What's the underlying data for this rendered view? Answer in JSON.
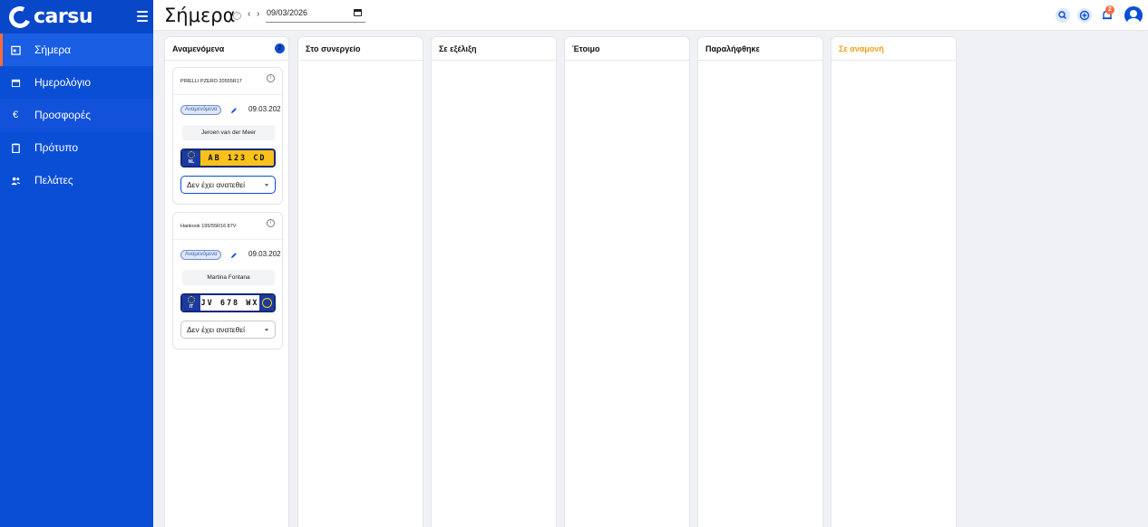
{
  "brand": {
    "name": "carsu"
  },
  "sidebar": {
    "items": [
      {
        "label": "Σήμερα",
        "icon": "today-icon"
      },
      {
        "label": "Ημερολόγιο",
        "icon": "calendar-icon"
      },
      {
        "label": "Προσφορές",
        "icon": "euro-icon"
      },
      {
        "label": "Πρότυπο",
        "icon": "clipboard-icon"
      },
      {
        "label": "Πελάτες",
        "icon": "users-icon"
      }
    ]
  },
  "header": {
    "title": "Σήμερα",
    "date": "09/03/2026",
    "notification_count": "2"
  },
  "columns": [
    {
      "title": "Αναμενόμενα",
      "count": "2",
      "color": "#111111"
    },
    {
      "title": "Στο συνεργείο",
      "color": "#111111"
    },
    {
      "title": "Σε εξέλιξη",
      "color": "#111111"
    },
    {
      "title": "Έτοιμο",
      "color": "#111111"
    },
    {
      "title": "Παραλήφθηκε",
      "color": "#111111"
    },
    {
      "title": "Σε αναμονή",
      "color": "#f0a020"
    }
  ],
  "cards": [
    {
      "tyre": "PIRELLI PZERO 20555R17",
      "status": "Αναμενόμενα",
      "date": "09.03.202",
      "customer": "Jeroen van der Meer",
      "plate": "AB 123 CD",
      "plate_country": "NL",
      "assignee": "Δεν έχει ανατεθεί"
    },
    {
      "tyre": "Hankook 195/55R16 87V",
      "status": "Αναμενόμενα",
      "date": "09.03.202",
      "customer": "Martina Fontana",
      "plate": "JV 678 WX",
      "plate_country": "IT",
      "assignee": "Δεν έχει ανατεθεί"
    }
  ],
  "colors": {
    "primary": "#0a4ed6",
    "accent": "#ff6a3d",
    "plate_nl": "#f8c21b"
  }
}
